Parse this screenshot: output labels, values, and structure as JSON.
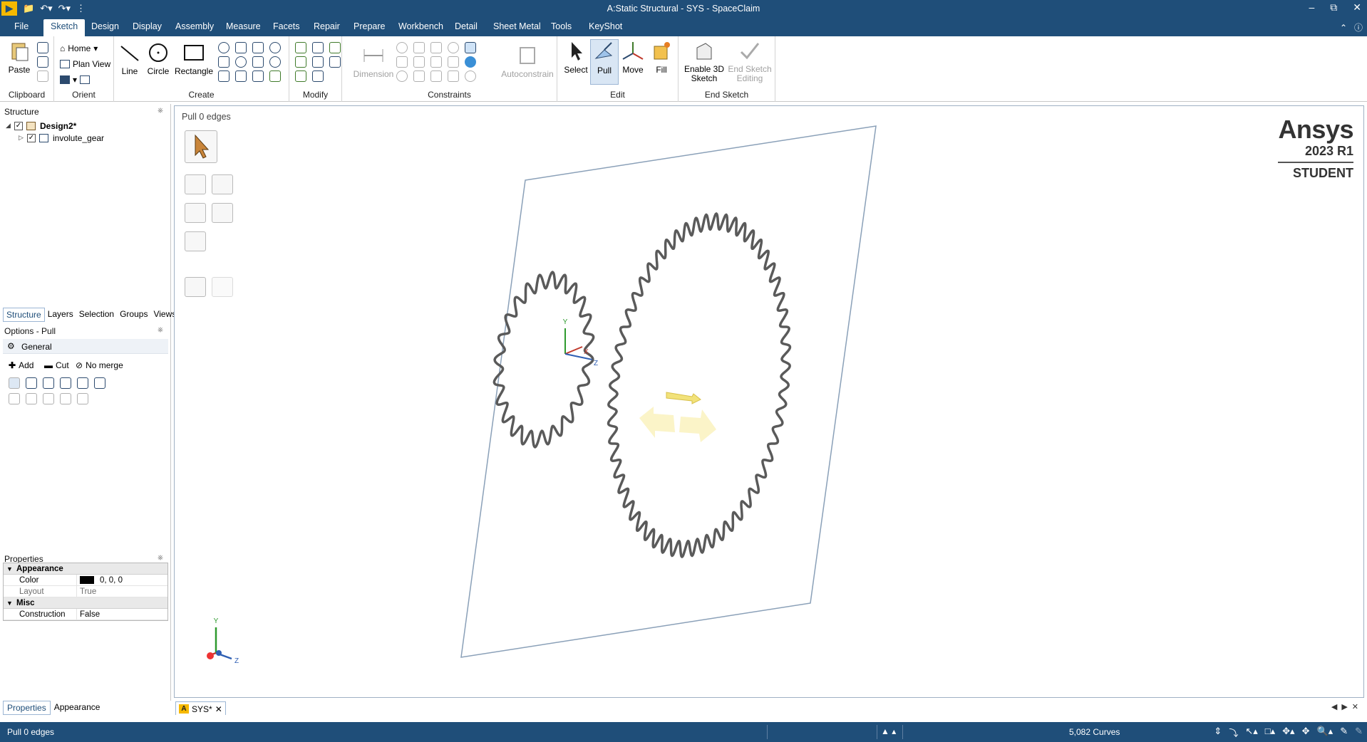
{
  "window": {
    "title": "A:Static Structural - SYS - SpaceClaim",
    "controls": [
      "–",
      "⧉",
      "✕"
    ]
  },
  "menubar": {
    "tabs": [
      "File",
      "Sketch",
      "Design",
      "Display",
      "Assembly",
      "Measure",
      "Facets",
      "Repair",
      "Prepare",
      "Workbench",
      "Detail",
      "Sheet Metal",
      "Tools",
      "KeyShot"
    ],
    "active": "Sketch"
  },
  "ribbon": {
    "clipboard": {
      "title": "Clipboard",
      "paste": "Paste"
    },
    "orient": {
      "title": "Orient",
      "home": "Home",
      "plan_view": "Plan View"
    },
    "create": {
      "title": "Create",
      "line": "Line",
      "circle": "Circle",
      "rectangle": "Rectangle"
    },
    "modify": {
      "title": "Modify"
    },
    "constraints": {
      "title": "Constraints",
      "dimension": "Dimension",
      "autoconstrain": "Autoconstrain"
    },
    "edit": {
      "title": "Edit",
      "select": "Select",
      "pull": "Pull",
      "move": "Move",
      "fill": "Fill"
    },
    "end_sketch": {
      "title": "End Sketch",
      "enable_3d": "Enable 3D Sketch",
      "end_editing": "End Sketch Editing"
    }
  },
  "structure": {
    "header": "Structure",
    "root": "Design2*",
    "child": "involute_gear"
  },
  "panel_tabs": [
    "Structure",
    "Layers",
    "Selection",
    "Groups",
    "Views"
  ],
  "options": {
    "header": "Options - Pull",
    "section": "General",
    "add": "Add",
    "cut": "Cut",
    "no_merge": "No merge"
  },
  "properties": {
    "header": "Properties",
    "appearance_label": "Appearance",
    "color_label": "Color",
    "color_value": "0, 0, 0",
    "layout_label": "Layout",
    "layout_value": "True",
    "misc_label": "Misc",
    "construction_label": "Construction",
    "construction_value": "False"
  },
  "bottom_tabs": [
    "Properties",
    "Appearance"
  ],
  "viewport": {
    "status": "Pull 0 edges",
    "brand_name": "Ansys",
    "brand_version": "2023 R1",
    "brand_edition": "STUDENT",
    "axis_y": "Y",
    "axis_x": "X",
    "axis_z": "Z"
  },
  "doc_tab": {
    "label": "SYS*",
    "close": "✕"
  },
  "statusbar": {
    "message": "Pull 0 edges",
    "curves": "5,082 Curves"
  },
  "colors": {
    "chrome_blue": "#1f4e79",
    "gear_stroke": "#5a5a5a",
    "plane_stroke": "#8aa0b8",
    "handle_yellow": "#f2e27a"
  }
}
